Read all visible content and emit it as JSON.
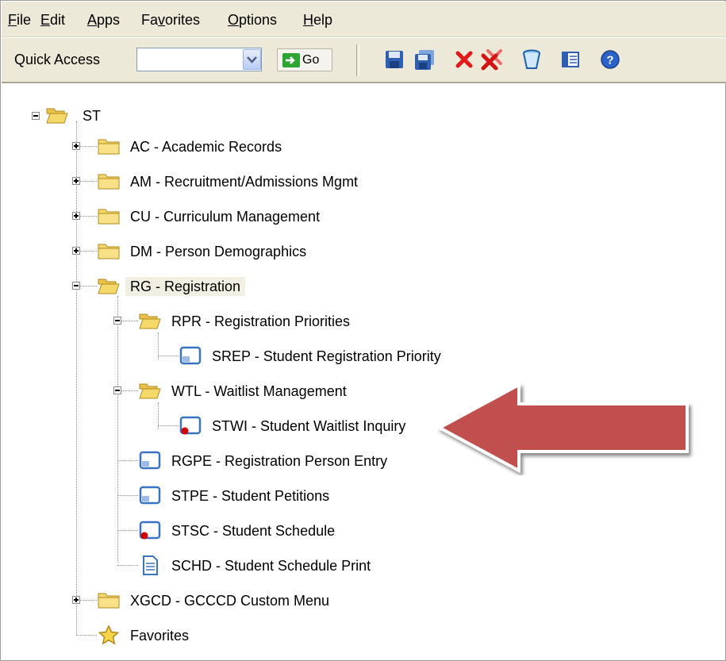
{
  "menu": [
    {
      "id": "file",
      "pre": "",
      "acc": "F",
      "post": "ile"
    },
    {
      "id": "edit",
      "pre": "",
      "acc": "E",
      "post": "dit"
    },
    {
      "id": "apps",
      "pre": "",
      "acc": "A",
      "post": "pps"
    },
    {
      "id": "favorites",
      "pre": "Fa",
      "acc": "v",
      "post": "orites"
    },
    {
      "id": "options",
      "pre": "",
      "acc": "O",
      "post": "ptions"
    },
    {
      "id": "help",
      "pre": "",
      "acc": "H",
      "post": "elp"
    }
  ],
  "toolbar": {
    "quick_access_label": "Quick Access",
    "quick_access_value": "",
    "go_label": "Go",
    "buttons": [
      "save-icon",
      "save-all-icon",
      "cancel-icon",
      "cancel-all-icon",
      "clear-icon",
      "list-icon",
      "help-icon"
    ]
  },
  "tree": {
    "root": {
      "label": "ST"
    },
    "nodes": {
      "ac": {
        "label": "AC - Academic Records"
      },
      "am": {
        "label": "AM - Recruitment/Admissions Mgmt"
      },
      "cu": {
        "label": "CU - Curriculum Management"
      },
      "dm": {
        "label": "DM - Person Demographics"
      },
      "rg": {
        "label": "RG - Registration"
      },
      "rpr": {
        "label": "RPR - Registration Priorities"
      },
      "srep": {
        "label": "SREP - Student Registration Priority"
      },
      "wtl": {
        "label": "WTL - Waitlist Management"
      },
      "stwi": {
        "label": "STWI - Student Waitlist Inquiry"
      },
      "rgpe": {
        "label": "RGPE - Registration Person Entry"
      },
      "stpe": {
        "label": "STPE - Student Petitions"
      },
      "stsc": {
        "label": "STSC - Student Schedule"
      },
      "schd": {
        "label": "SCHD - Student Schedule Print"
      },
      "xgcd": {
        "label": "XGCD - GCCCD Custom Menu"
      },
      "favorites": {
        "label": "Favorites"
      }
    },
    "selected": "rg"
  },
  "colors": {
    "chrome": "#ece9d8",
    "folder": "#f5d86a",
    "arrow": "#c0504d",
    "form_icon": "#3a73c4",
    "alert_dot": "#d00000"
  }
}
